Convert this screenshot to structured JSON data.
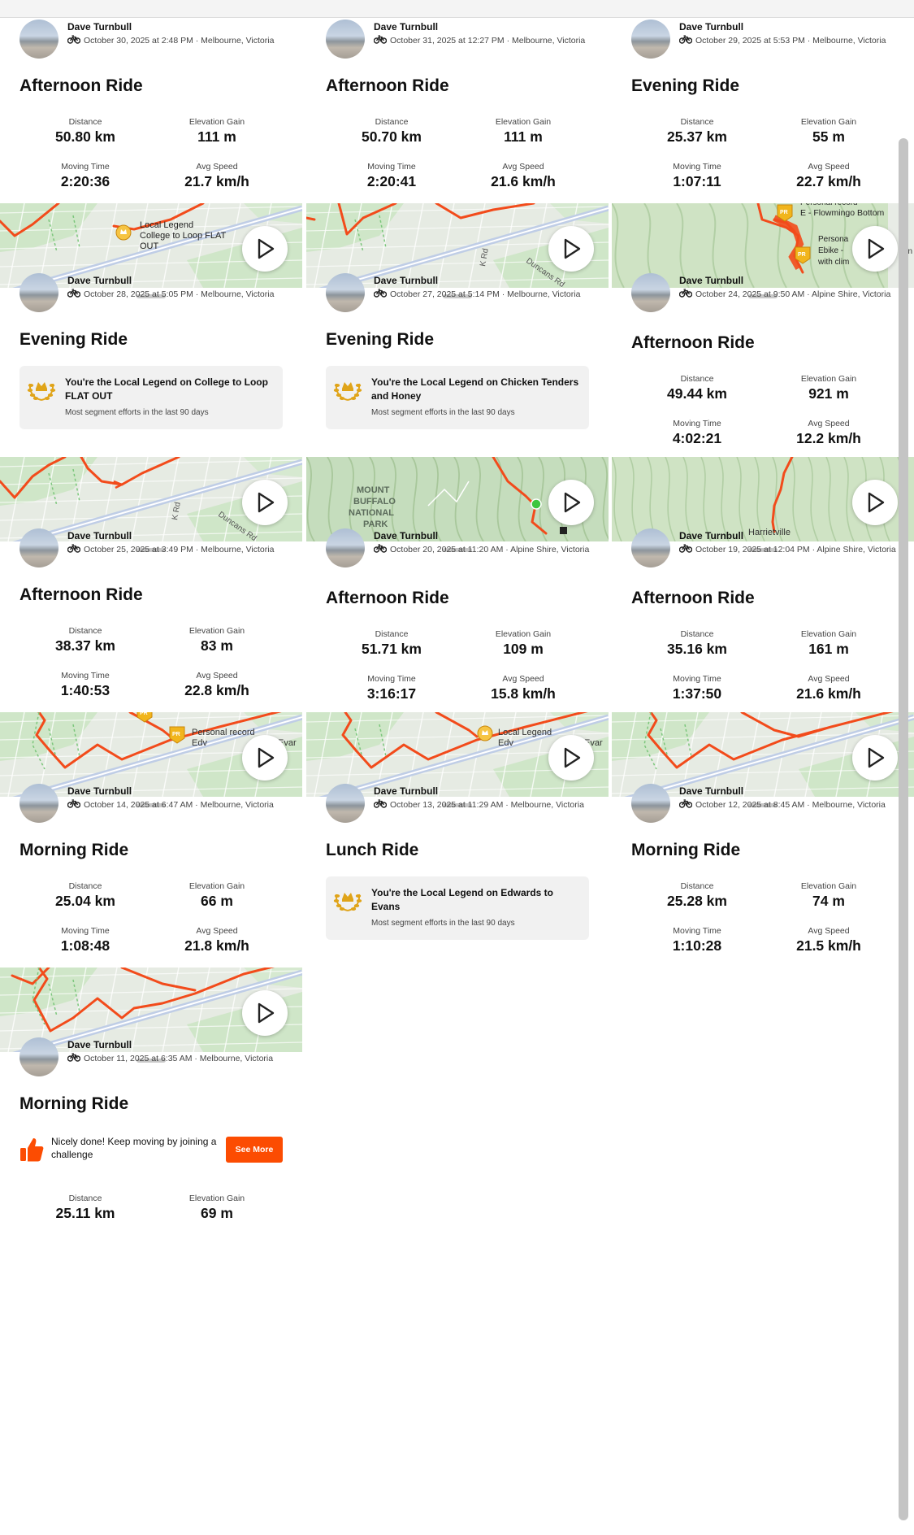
{
  "athlete_name": "Dave Turnbull",
  "labels": {
    "distance": "Distance",
    "elevation": "Elevation Gain",
    "moving_time": "Moving Time",
    "avg_speed": "Avg Speed",
    "see_more": "See More",
    "legend_sub": "Most segment efforts in the last 90 days"
  },
  "colors": {
    "accent": "#fc4c02",
    "route": "#f24b1b",
    "map_green": "#cfe6c8",
    "map_road": "#bfcde6"
  },
  "icons": {
    "activity": "bike-icon",
    "play": "play-icon",
    "legend": "laurel-icon",
    "challenge": "thumbs-up-icon"
  },
  "activities": [
    {
      "date": "October 30, 2025 at 2:48 PM · Melbourne, Victoria",
      "title": "Afternoon Ride",
      "distance": "50.80 km",
      "elevation": "111 m",
      "moving_time": "2:20:36",
      "avg_speed": "21.7 km/h",
      "map_labels": [
        "Local Legend",
        "College to Loop FLAT",
        "OUT"
      ]
    },
    {
      "date": "October 31, 2025 at 12:27 PM · Melbourne, Victoria",
      "title": "Afternoon Ride",
      "distance": "50.70 km",
      "elevation": "111 m",
      "moving_time": "2:20:41",
      "avg_speed": "21.6 km/h",
      "map_labels": [
        "K Rd",
        "Duncans Rd"
      ]
    },
    {
      "date": "October 29, 2025 at 5:53 PM · Melbourne, Victoria",
      "title": "Evening Ride",
      "distance": "25.37 km",
      "elevation": "55 m",
      "moving_time": "1:07:11",
      "avg_speed": "22.7 km/h",
      "map_labels": [
        "Personal record",
        "E - Flowmingo Bottom",
        "Persona",
        "Ebike - ",
        "with clim",
        "lin"
      ]
    },
    {
      "date": "October 28, 2025 at 5:05 PM · Melbourne, Victoria",
      "title": "Evening Ride",
      "legend": "You're the Local Legend on College to Loop FLAT OUT",
      "map_labels": [
        "K Rd",
        "Duncans Rd"
      ]
    },
    {
      "date": "October 27, 2025 at 5:14 PM · Melbourne, Victoria",
      "title": "Evening Ride",
      "legend": "You're the Local Legend on Chicken Tenders and Honey",
      "map_labels": [
        "MOUNT",
        "BUFFALO",
        "NATIONAL",
        "PARK"
      ]
    },
    {
      "date": "October 24, 2025 at 9:50 AM · Alpine Shire, Victoria",
      "title": "Afternoon Ride",
      "distance": "49.44 km",
      "elevation": "921 m",
      "moving_time": "4:02:21",
      "avg_speed": "12.2 km/h",
      "map_labels": [
        "Harrietville"
      ]
    },
    {
      "date": "October 25, 2025 at 3:49 PM · Melbourne, Victoria",
      "title": "Afternoon Ride",
      "distance": "38.37 km",
      "elevation": "83 m",
      "moving_time": "1:40:53",
      "avg_speed": "22.8 km/h",
      "map_labels": [
        "Personal record",
        "Edv",
        "Evar"
      ]
    },
    {
      "date": "October 20, 2025 at 11:20 AM · Alpine Shire, Victoria",
      "title": "Afternoon Ride",
      "distance": "51.71 km",
      "elevation": "109 m",
      "moving_time": "3:16:17",
      "avg_speed": "15.8 km/h",
      "map_labels": [
        "Local Legend",
        "Edv",
        "Evar"
      ]
    },
    {
      "date": "October 19, 2025 at 12:04 PM · Alpine Shire, Victoria",
      "title": "Afternoon Ride",
      "distance": "35.16 km",
      "elevation": "161 m",
      "moving_time": "1:37:50",
      "avg_speed": "21.6 km/h",
      "map_labels": []
    },
    {
      "date": "October 14, 2025 at 6:47 AM · Melbourne, Victoria",
      "title": "Morning Ride",
      "distance": "25.04 km",
      "elevation": "66 m",
      "moving_time": "1:08:48",
      "avg_speed": "21.8 km/h",
      "map_labels": []
    },
    {
      "date": "October 13, 2025 at 11:29 AM · Melbourne, Victoria",
      "title": "Lunch Ride",
      "legend": "You're the Local Legend on Edwards to Evans"
    },
    {
      "date": "October 12, 2025 at 8:45 AM · Melbourne, Victoria",
      "title": "Morning Ride",
      "distance": "25.28 km",
      "elevation": "74 m",
      "moving_time": "1:10:28",
      "avg_speed": "21.5 km/h"
    },
    {
      "date": "October 11, 2025 at 6:35 AM · Melbourne, Victoria",
      "title": "Morning Ride",
      "challenge": "Nicely done! Keep moving by joining a challenge",
      "distance": "25.11 km",
      "elevation": "69 m"
    }
  ]
}
